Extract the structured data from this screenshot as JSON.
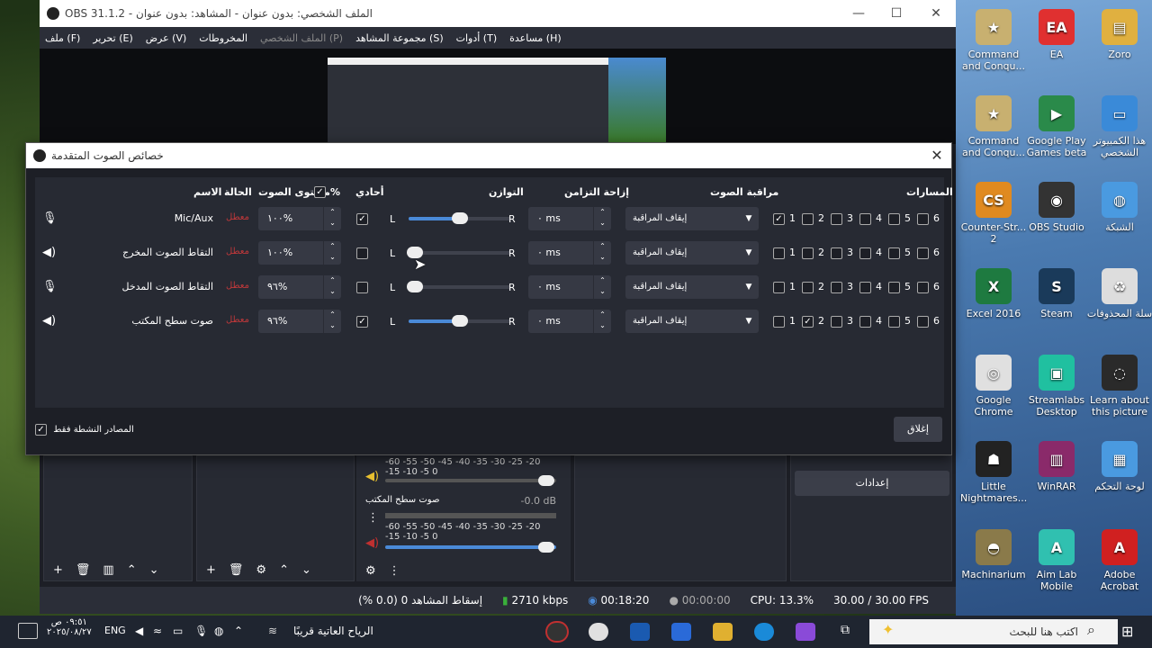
{
  "obs": {
    "title": "OBS 31.1.2 - الملف الشخصي: بدون عنوان - المشاهد: بدون عنوان",
    "menu": [
      "ملف (F)",
      "تحرير (E)",
      "عرض (V)",
      "المخروطات",
      "الملف الشخصي (P)",
      "مجموعة المشاهد (S)",
      "أدوات (T)",
      "مساعدة (H)"
    ],
    "mixer": {
      "scale": "-60 -55 -50 -45 -40 -35 -30 -25 -20 -15 -10 -5 0",
      "source_name": "صوت سطح المكتب",
      "db": "-0.0 dB"
    },
    "settings_button": "إعدادات",
    "status": {
      "dropped": "إسقاط المشاهد 0 (0.0 %)",
      "bitrate": "2710 kbps",
      "rec_time": "00:18:20",
      "stream_time": "00:00:00",
      "cpu": "CPU: 13.3%",
      "fps": "30.00 / 30.00 FPS"
    }
  },
  "dialog": {
    "title": "خصائص الصوت المتقدمة",
    "headers": {
      "name": "الاسم",
      "status": "الحالة",
      "volume": "مستوى الصوت",
      "percent": "%",
      "mono": "أحادي",
      "balance": "التوازن",
      "sync": "إزاحة التزامن",
      "monitor": "مراقبة الصوت",
      "tracks": "المسارات"
    },
    "balance_left": "L",
    "balance_right": "R",
    "status_text": "معطل",
    "rows": [
      {
        "name": "Mic/Aux",
        "volume": "١٠٠%",
        "mono": true,
        "balance": 0.5,
        "sync": "٠ ms",
        "monitor": "إيقاف المراقبة",
        "tracks": [
          true,
          false,
          false,
          false,
          false,
          false
        ]
      },
      {
        "name": "التقاط الصوت المخرج",
        "volume": "١٠٠%",
        "mono": false,
        "balance": 0.0,
        "sync": "٠ ms",
        "monitor": "إيقاف المراقبة",
        "tracks": [
          false,
          false,
          false,
          false,
          false,
          false
        ]
      },
      {
        "name": "التقاط الصوت المدخل",
        "volume": "٩٦%",
        "mono": false,
        "balance": 0.0,
        "sync": "٠ ms",
        "monitor": "إيقاف المراقبة",
        "tracks": [
          false,
          false,
          false,
          false,
          false,
          false
        ]
      },
      {
        "name": "صوت سطح المكتب",
        "volume": "٩٦%",
        "mono": true,
        "balance": 0.5,
        "sync": "٠ ms",
        "monitor": "إيقاف المراقبة",
        "tracks": [
          false,
          true,
          false,
          false,
          false,
          false
        ]
      }
    ],
    "track_numbers": [
      "1",
      "2",
      "3",
      "4",
      "5",
      "6"
    ],
    "active_only_label": "المصادر النشطة فقط",
    "close_button": "إغلاق"
  },
  "desktop_icons": [
    {
      "label": "Command and Conqu...",
      "color": "#c8b070",
      "glyph": "★"
    },
    {
      "label": "EA",
      "color": "#e03030",
      "glyph": "EA"
    },
    {
      "label": "Zoro",
      "color": "#e0b040",
      "glyph": "▤"
    },
    {
      "label": "Command and Conqu...",
      "color": "#c8b070",
      "glyph": "★"
    },
    {
      "label": "Google Play Games beta",
      "color": "#2a8a4a",
      "glyph": "▶"
    },
    {
      "label": "هذا الكمبيوتر الشخصي",
      "color": "#3a8ad8",
      "glyph": "▭"
    },
    {
      "label": "Counter-Str... 2",
      "color": "#e08a20",
      "glyph": "CS"
    },
    {
      "label": "OBS Studio",
      "color": "#333",
      "glyph": "◉"
    },
    {
      "label": "الشبكة",
      "color": "#4a9ae0",
      "glyph": "◍"
    },
    {
      "label": "Excel 2016",
      "color": "#1e7a40",
      "glyph": "X"
    },
    {
      "label": "Steam",
      "color": "#1a3a5a",
      "glyph": "S"
    },
    {
      "label": "سلة المحذوفات",
      "color": "#ddd",
      "glyph": "♻"
    },
    {
      "label": "Google Chrome",
      "color": "#e0e0e0",
      "glyph": "◎"
    },
    {
      "label": "Streamlabs Desktop",
      "color": "#20c0a0",
      "glyph": "▣"
    },
    {
      "label": "Learn about this picture",
      "color": "#2a2a2a",
      "glyph": "◌"
    },
    {
      "label": "Little Nightmares...",
      "color": "#222",
      "glyph": "☗"
    },
    {
      "label": "WinRAR",
      "color": "#8a2a6a",
      "glyph": "▥"
    },
    {
      "label": "لوحة التحكم",
      "color": "#4a9ae0",
      "glyph": "▦"
    },
    {
      "label": "Machinarium",
      "color": "#8a7a4a",
      "glyph": "◓"
    },
    {
      "label": "Aim Lab Mobile",
      "color": "#30c0b0",
      "glyph": "A"
    },
    {
      "label": "Adobe Acrobat",
      "color": "#d02020",
      "glyph": "A"
    }
  ],
  "taskbar": {
    "search_placeholder": "اكتب هنا للبحث",
    "weather": "الرياح العاتية قريبًا",
    "lang": "ENG",
    "time": "٠٩:٥١ ص",
    "date": "٢٠٢٥/٠٨/٢٧"
  }
}
